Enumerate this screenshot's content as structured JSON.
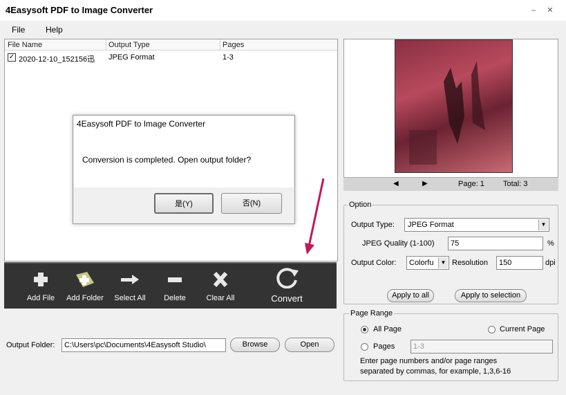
{
  "window": {
    "title": "4Easysoft PDF to Image Converter"
  },
  "menu": {
    "items": [
      "File",
      "Help"
    ]
  },
  "file_list": {
    "columns": [
      "File Name",
      "Output Type",
      "Pages"
    ],
    "rows": [
      {
        "checked": true,
        "name": "2020-12-10_152156迅",
        "type": "JPEG Format",
        "pages": "1-3"
      }
    ]
  },
  "dialog": {
    "title": "4Easysoft PDF to Image Converter",
    "message": "Conversion is completed. Open output folder?",
    "yes_label": "是(Y)",
    "no_label": "否(N)"
  },
  "toolbar": {
    "add_file": "Add File",
    "add_folder": "Add Folder",
    "select_all": "Select All",
    "delete": "Delete",
    "clear_all": "Clear All",
    "convert": "Convert"
  },
  "output": {
    "label": "Output Folder:",
    "path": "C:\\Users\\pc\\Documents\\4Easysoft Studio\\",
    "browse": "Browse",
    "open": "Open"
  },
  "preview": {
    "page_label": "Page: 1",
    "total_label": "Total: 3"
  },
  "option": {
    "legend": "Option",
    "output_type_label": "Output Type:",
    "output_type_value": "JPEG Format",
    "jpeg_quality_label": "JPEG Quality (1-100)",
    "jpeg_quality_value": "75",
    "percent": "%",
    "output_color_label": "Output Color:",
    "output_color_value": "Colorfu",
    "resolution_label": "Resolution",
    "resolution_value": "150",
    "resolution_unit": "dpi",
    "apply_all": "Apply to all",
    "apply_selection": "Apply to selection"
  },
  "page_range": {
    "legend": "Page Range",
    "all_page": "All Page",
    "current_page": "Current Page",
    "pages": "Pages",
    "pages_value": "1-3",
    "hint_line1": "Enter page numbers and/or page ranges",
    "hint_line2": "separated by commas, for example, 1,3,6-16"
  }
}
